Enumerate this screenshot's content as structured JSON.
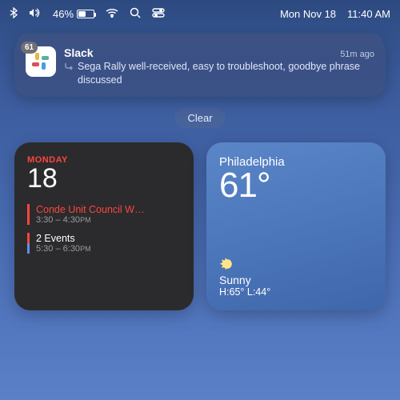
{
  "menubar": {
    "battery_pct": "46%",
    "date": "Mon Nov 18",
    "time": "11:40 AM"
  },
  "notification": {
    "badge": "61",
    "app": "Slack",
    "age": "51m ago",
    "message": "Sega Rally well-received, easy to troubleshoot, goodbye phrase discussed"
  },
  "clear_label": "Clear",
  "calendar": {
    "day_name": "MONDAY",
    "day_num": "18",
    "event1_title": "Conde Unit Council W…",
    "event1_time": "3:30 – 4:30",
    "event1_ampm": "PM",
    "event2_title": "2 Events",
    "event2_time": "5:30 – 6:30",
    "event2_ampm": "PM"
  },
  "weather": {
    "location": "Philadelphia",
    "temp": "61°",
    "condition": "Sunny",
    "hilo": "H:65° L:44°"
  }
}
